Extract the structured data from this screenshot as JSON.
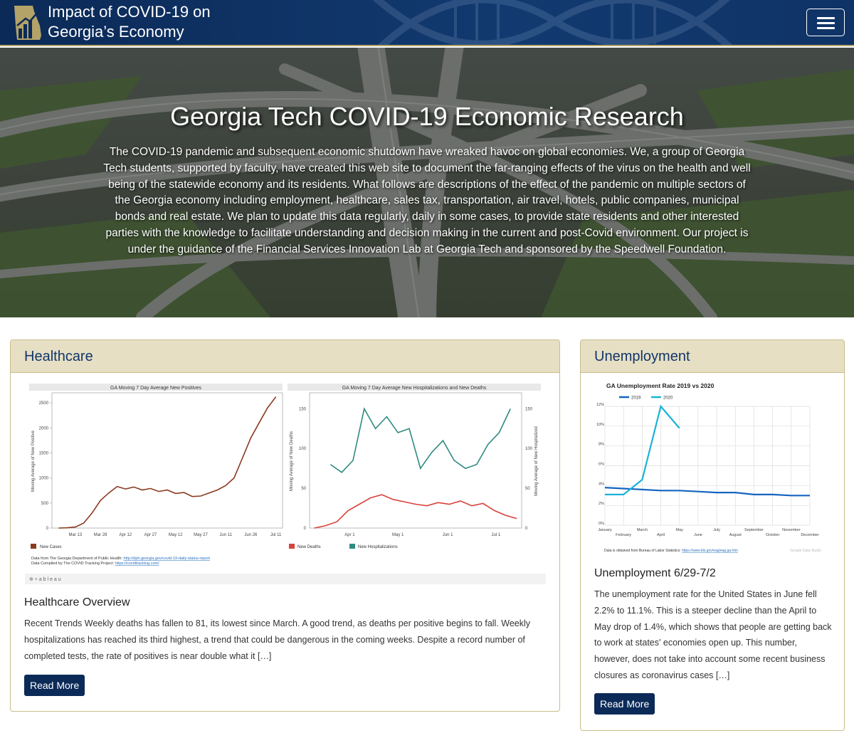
{
  "nav": {
    "brand_line1": "Impact of COVID-19 on",
    "brand_line2": "Georgia’s Economy",
    "menu_icon": "hamburger-icon"
  },
  "hero": {
    "title": "Georgia Tech COVID-19 Economic Research",
    "text": "The COVID-19 pandemic and subsequent economic shutdown  have wreaked havoc on global economies. We, a group of Georgia Tech students, supported by faculty, have created this web site to document the far-ranging effects of the virus on the health and well being of the statewide economy and its residents. What follows are descriptions of the effect of the pandemic on multiple sectors of the Georgia economy including employment, healthcare, sales tax, transportation, air travel, hotels, public companies, municipal bonds and real estate. We plan to update this data regularly, daily in some cases, to provide state residents and other interested parties with the knowledge to facilitate understanding and decision making in the current and post-Covid environment. Our project is under the guidance of the Financial Services Innovation Lab at Georgia Tech and sponsored by the Speedwell Foundation."
  },
  "healthcare": {
    "header": "Healthcare",
    "overview_title": "Healthcare Overview",
    "overview_text": "Recent Trends Weekly deaths has fallen to 81, its lowest since March. A good trend, as deaths per positive begins to fall. Weekly hospitalizations has reached its third highest, a trend that could be dangerous in the coming weeks. Despite a record number of completed tests, the rate of positives is near double what it […]",
    "read_more": "Read More",
    "source_line1": "Data from The Georgia Department of Public Health: ",
    "source_link1": "http://dph.georgia.gov/covid-19-daily-status-report",
    "source_line2": "Data Compiled by The COVID Tracking Project: ",
    "source_link2": "https://covidtracking.com/",
    "tableau_label": "+ a b l e a u"
  },
  "unemployment": {
    "header": "Unemployment",
    "sub_title": "Unemployment 6/29-7/2",
    "text": "The unemployment rate for the United States in June fell 2.2% to 11.1%. This is a steeper decline than the April to May drop of 1.4%, which shows that people are getting back to work at states' economies open up. This number, however, does not take into account some recent business closures as coronavirus cases […]",
    "read_more": "Read More",
    "source_text": "Data is obtained from Bureau of Labor Statistics: ",
    "source_link": "https://www.bls.gov/eag/eag.ga.htm",
    "credit": "Google Data Studio"
  },
  "colors": {
    "navy": "#0b2a57",
    "gold": "#b3a369",
    "cases": "#8b3a1f",
    "deaths": "#d9423b",
    "hosp": "#2e8b80",
    "u2019": "#1565c0",
    "u2020": "#1ab3d9"
  },
  "chart_data": [
    {
      "type": "line",
      "title": "GA Moving 7 Day Average New Positives",
      "ylabel": "Moving Average of New Positive",
      "x_ticks": [
        "Mar 13",
        "Mar 28",
        "Apr 12",
        "Apr 27",
        "May 12",
        "May 27",
        "Jun 11",
        "Jun 26",
        "Jul 11"
      ],
      "y_ticks": [
        "0",
        "500",
        "1000",
        "1500",
        "2000",
        "2500"
      ],
      "ylim": [
        0,
        2700
      ],
      "legend": [
        "New Cases"
      ],
      "series": [
        {
          "name": "New Cases",
          "x": [
            "Mar 3",
            "Mar 8",
            "Mar 13",
            "Mar 18",
            "Mar 23",
            "Mar 28",
            "Apr 2",
            "Apr 7",
            "Apr 12",
            "Apr 17",
            "Apr 22",
            "Apr 27",
            "May 2",
            "May 7",
            "May 12",
            "May 17",
            "May 22",
            "May 27",
            "Jun 1",
            "Jun 6",
            "Jun 11",
            "Jun 16",
            "Jun 21",
            "Jun 26",
            "Jul 1",
            "Jul 6",
            "Jul 11"
          ],
          "values": [
            0,
            5,
            20,
            100,
            300,
            550,
            700,
            830,
            780,
            820,
            760,
            790,
            730,
            760,
            690,
            710,
            630,
            640,
            700,
            760,
            850,
            1000,
            1400,
            1800,
            2100,
            2400,
            2620
          ]
        }
      ]
    },
    {
      "type": "line",
      "title": "GA Moving 7 Day Average New Hospitalizations and New Deaths",
      "ylabel": "Moving Average of New Deaths",
      "y2label": "Moving Average of New Hospitalized",
      "x_ticks": [
        "Apr 1",
        "May 1",
        "Jun 1",
        "Jul 1"
      ],
      "y_ticks": [
        "0",
        "50",
        "100",
        "150"
      ],
      "y2_ticks": [
        "0",
        "50",
        "100",
        "150"
      ],
      "ylim": [
        0,
        170
      ],
      "legend": [
        "New Deaths",
        "New Hospitalizations"
      ],
      "series": [
        {
          "name": "New Hospitalizations",
          "x": [
            "Mar 20",
            "Mar 27",
            "Apr 3",
            "Apr 10",
            "Apr 17",
            "Apr 24",
            "May 1",
            "May 8",
            "May 15",
            "May 22",
            "May 29",
            "Jun 5",
            "Jun 12",
            "Jun 19",
            "Jun 26",
            "Jul 3",
            "Jul 10"
          ],
          "values": [
            80,
            70,
            85,
            150,
            125,
            140,
            120,
            125,
            75,
            95,
            110,
            85,
            75,
            80,
            105,
            120,
            150
          ]
        },
        {
          "name": "New Deaths",
          "x": [
            "Mar 10",
            "Mar 17",
            "Mar 24",
            "Mar 31",
            "Apr 7",
            "Apr 14",
            "Apr 21",
            "Apr 28",
            "May 5",
            "May 12",
            "May 19",
            "May 26",
            "Jun 2",
            "Jun 9",
            "Jun 16",
            "Jun 23",
            "Jun 30",
            "Jul 7",
            "Jul 14"
          ],
          "values": [
            0,
            3,
            8,
            22,
            30,
            38,
            42,
            36,
            33,
            30,
            28,
            32,
            30,
            34,
            28,
            31,
            22,
            16,
            12
          ]
        }
      ]
    },
    {
      "type": "line",
      "title": "GA Unemployment Rate 2019 vs 2020",
      "categories": [
        "January",
        "February",
        "March",
        "April",
        "May",
        "June",
        "July",
        "August",
        "September",
        "October",
        "November",
        "December"
      ],
      "y_ticks": [
        "0%",
        "2%",
        "4%",
        "6%",
        "8%",
        "10%",
        "12%"
      ],
      "ylim": [
        0,
        12
      ],
      "legend": [
        "2019",
        "2020"
      ],
      "series": [
        {
          "name": "2019",
          "values": [
            3.8,
            3.7,
            3.6,
            3.5,
            3.5,
            3.4,
            3.3,
            3.3,
            3.1,
            3.1,
            3.0,
            3.0
          ]
        },
        {
          "name": "2020",
          "values": [
            3.1,
            3.1,
            4.6,
            12.0,
            9.8
          ]
        }
      ]
    }
  ]
}
